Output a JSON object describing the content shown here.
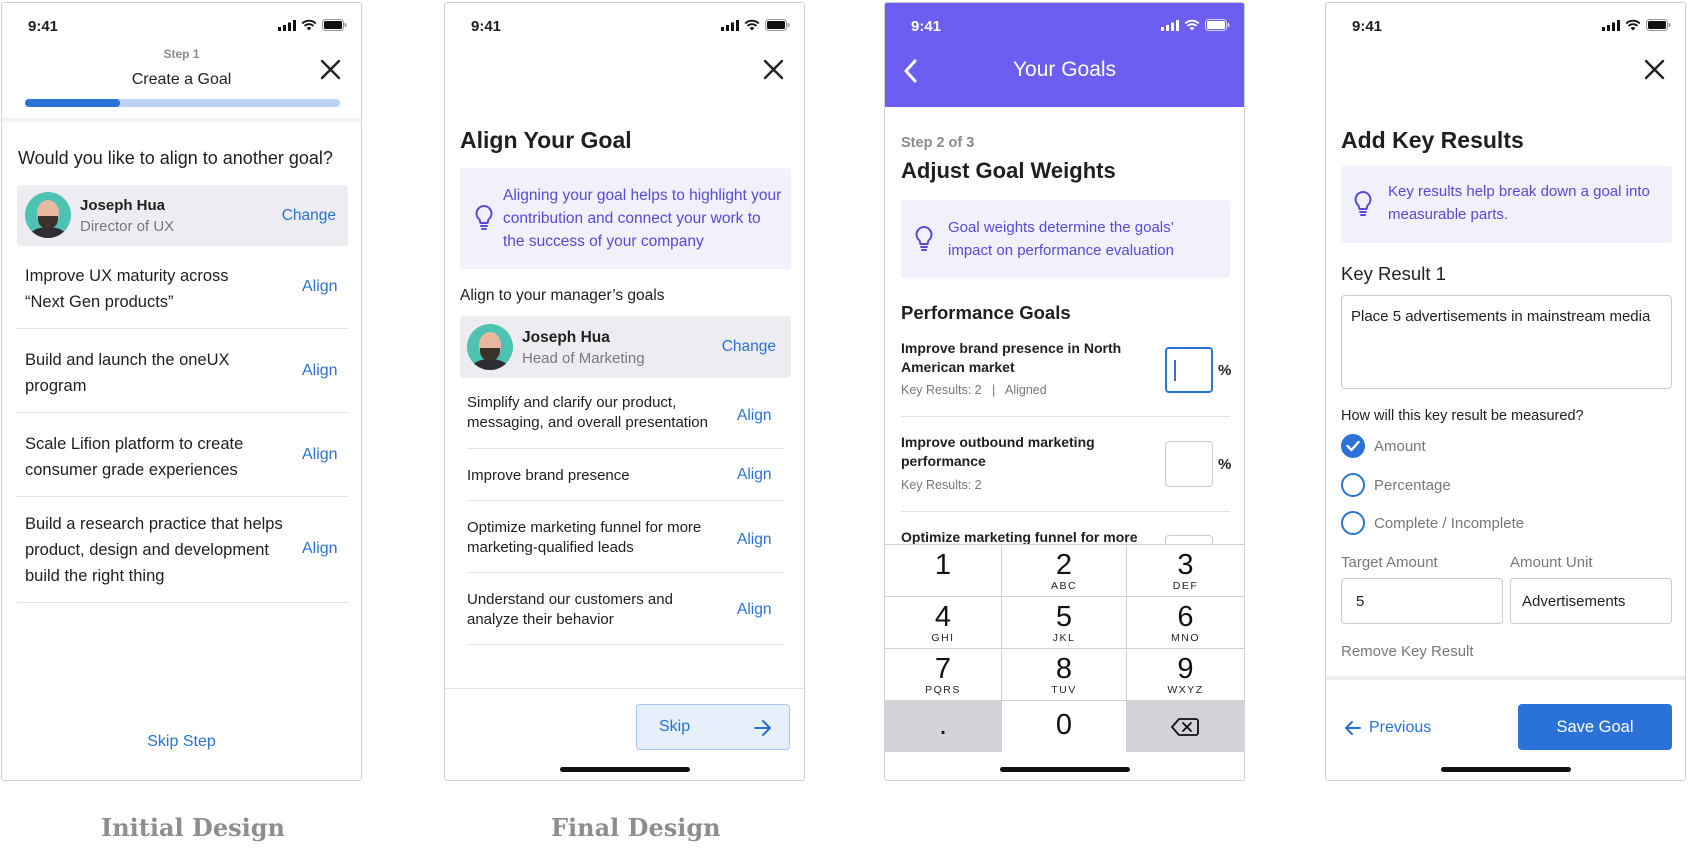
{
  "status_time": "9:41",
  "captions": {
    "initial": "Initial Design",
    "final": "Final Design"
  },
  "p1": {
    "step": "Step 1",
    "title": "Create a Goal",
    "progress": 0.3,
    "question": "Would you like to align to another goal?",
    "person": {
      "name": "Joseph Hua",
      "role": "Director of UX",
      "change": "Change"
    },
    "goals": [
      {
        "text": "Improve UX maturity across “Next Gen products”",
        "action": "Align"
      },
      {
        "text": "Build and launch the oneUX program",
        "action": "Align"
      },
      {
        "text": "Scale Lifion platform to create consumer grade experiences",
        "action": "Align"
      },
      {
        "text": "Build a research practice that helps product, design and development build the right thing",
        "action": "Align"
      }
    ],
    "skip": "Skip Step"
  },
  "p2": {
    "title": "Align Your Goal",
    "hint": "Aligning your goal helps to highlight your contribution and connect your work to the success of your company",
    "subtitle": "Align to your manager’s goals",
    "person": {
      "name": "Joseph Hua",
      "role": "Head of Marketing",
      "change": "Change"
    },
    "goals": [
      {
        "text": "Simplify and clarify our product, messaging, and overall presentation",
        "action": "Align"
      },
      {
        "text": "Improve brand presence",
        "action": "Align"
      },
      {
        "text": "Optimize marketing funnel for more marketing-qualified leads",
        "action": "Align"
      },
      {
        "text": "Understand our customers and analyze their behavior",
        "action": "Align"
      }
    ],
    "skip": "Skip"
  },
  "p3": {
    "header": "Your Goals",
    "step": "Step 2 of 3",
    "title": "Adjust Goal Weights",
    "hint": "Goal weights determine the goals’ impact on performance evaluation",
    "section": "Performance Goals",
    "goals": [
      {
        "title": "Improve brand presence in North American market",
        "meta": "Key Results: 2   |   Aligned",
        "unit": "%"
      },
      {
        "title": "Improve outbound marketing performance",
        "meta": "Key Results: 2",
        "unit": "%"
      },
      {
        "title": "Optimize marketing funnel for more",
        "meta": "",
        "unit": ""
      }
    ],
    "keys": [
      {
        "d": "1",
        "l": ""
      },
      {
        "d": "2",
        "l": "ABC"
      },
      {
        "d": "3",
        "l": "DEF"
      },
      {
        "d": "4",
        "l": "GHI"
      },
      {
        "d": "5",
        "l": "JKL"
      },
      {
        "d": "6",
        "l": "MNO"
      },
      {
        "d": "7",
        "l": "PQRS"
      },
      {
        "d": "8",
        "l": "TUV"
      },
      {
        "d": "9",
        "l": "WXYZ"
      },
      {
        "d": ".",
        "l": ""
      },
      {
        "d": "0",
        "l": ""
      },
      {
        "d": "",
        "l": ""
      }
    ]
  },
  "p4": {
    "title": "Add Key Results",
    "hint": "Key results help break down a goal into measurable parts.",
    "kr_label": "Key Result 1",
    "kr_value": "Place 5 advertisements in mainstream media",
    "question": "How will this key result be measured?",
    "options": [
      {
        "label": "Amount",
        "checked": true
      },
      {
        "label": "Percentage",
        "checked": false
      },
      {
        "label": "Complete / Incomplete",
        "checked": false
      }
    ],
    "target_label": "Target Amount",
    "target_value": "5",
    "unit_label": "Amount Unit",
    "unit_value": "Advertisements",
    "remove": "Remove Key Result",
    "previous": "Previous",
    "save": "Save Goal"
  },
  "colors": {
    "blue": "#2a72d8",
    "purple": "#5a48d9",
    "header_purple": "#6b5ef0"
  }
}
